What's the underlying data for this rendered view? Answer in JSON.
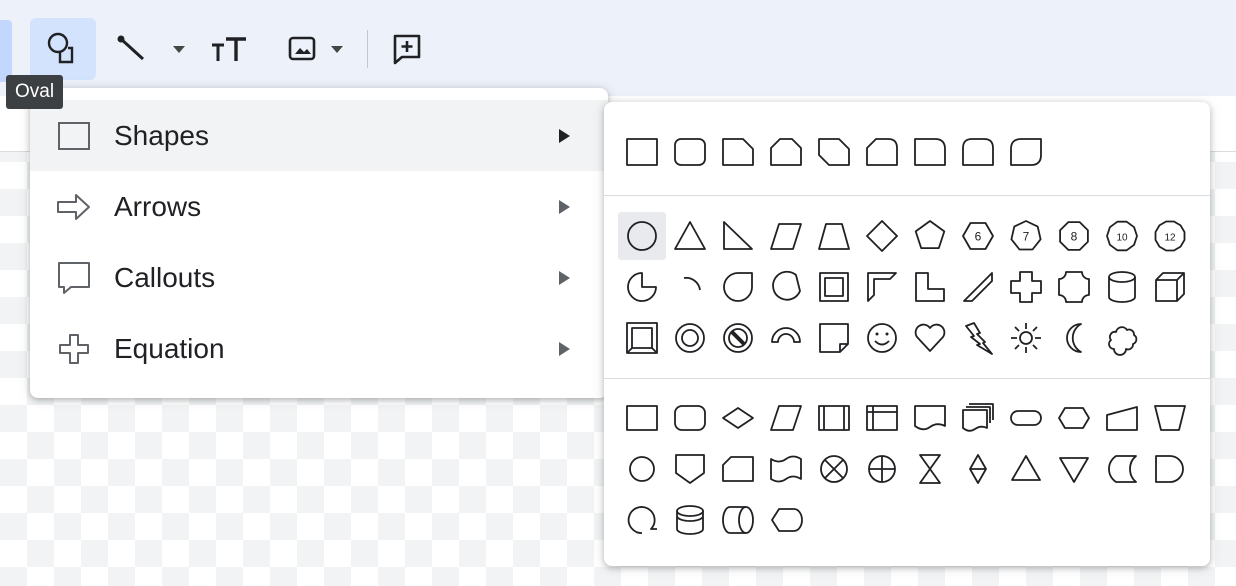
{
  "toolbar": {
    "buttons": [
      {
        "name": "shape-button",
        "icon": "shape-icon"
      },
      {
        "name": "line-button",
        "icon": "line-icon"
      },
      {
        "name": "text-box-button",
        "icon": "text-box-icon"
      },
      {
        "name": "image-button",
        "icon": "image-icon"
      },
      {
        "name": "comment-button",
        "icon": "add-comment-icon"
      }
    ]
  },
  "tooltip": {
    "text": "Oval"
  },
  "menu": {
    "items": [
      {
        "label": "Shapes",
        "icon": "rectangle-icon"
      },
      {
        "label": "Arrows",
        "icon": "arrow-right-icon"
      },
      {
        "label": "Callouts",
        "icon": "callout-icon"
      },
      {
        "label": "Equation",
        "icon": "plus-outline-icon"
      }
    ]
  },
  "submenu": {
    "sections": [
      {
        "name": "rectangles",
        "shapes": [
          "rectangle",
          "rounded-rectangle",
          "snip-single-corner",
          "snip-same-side-corners",
          "snip-diagonal-corners",
          "snip-and-round",
          "round-single-corner",
          "round-same-side-corners",
          "round-diagonal-corners"
        ]
      },
      {
        "name": "basic",
        "shapes": [
          "oval",
          "triangle",
          "right-triangle",
          "parallelogram",
          "trapezoid",
          "diamond",
          "pentagon",
          "hexagon-6",
          "heptagon-7",
          "octagon-8",
          "decagon-10",
          "dodecagon-12",
          "pie",
          "arc",
          "tear",
          "chord",
          "frame",
          "half-frame",
          "l-shape",
          "diagonal-stripe",
          "cross",
          "plaque",
          "can",
          "cube",
          "bevel",
          "donut",
          "no-symbol",
          "block-arc",
          "folded-corner",
          "smiley-face",
          "heart",
          "lightning-bolt",
          "sun",
          "moon",
          "cloud"
        ]
      },
      {
        "name": "flowchart",
        "shapes": [
          "process",
          "alternate-process",
          "decision",
          "data",
          "predefined-process",
          "internal-storage",
          "document",
          "multidocument",
          "terminator",
          "preparation",
          "manual-input",
          "manual-operation",
          "connector",
          "off-page-connector",
          "card",
          "punched-tape",
          "summing-junction",
          "or",
          "collate",
          "sort",
          "extract",
          "merge",
          "stored-data",
          "delay",
          "sequential-access-storage",
          "magnetic-disk",
          "direct-access-storage",
          "display"
        ]
      }
    ],
    "badges": {
      "hexagon-6": "6",
      "heptagon-7": "7",
      "octagon-8": "8",
      "decagon-10": "10",
      "dodecagon-12": "12"
    },
    "hovered_shape": "oval"
  },
  "colors": {
    "toolbar_bg": "#edf2fa",
    "active_button_bg": "#d3e3fd",
    "icon_stroke": "#202124",
    "menu_hover_bg": "#f1f3f4",
    "tooltip_bg": "#3c4043"
  }
}
